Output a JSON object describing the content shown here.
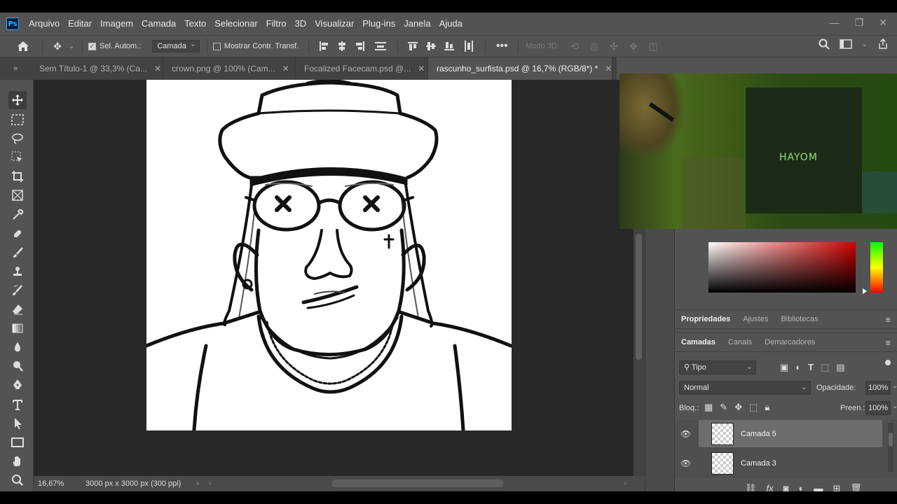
{
  "app": {
    "logo": "Ps"
  },
  "menu": [
    "Arquivo",
    "Editar",
    "Imagem",
    "Camada",
    "Texto",
    "Selecionar",
    "Filtro",
    "3D",
    "Visualizar",
    "Plug-ins",
    "Janela",
    "Ajuda"
  ],
  "options": {
    "auto_select_label": "Sel. Autom.:",
    "auto_select_value": "Camada",
    "transform_controls_label": "Mostrar Contr. Transf.",
    "mode3d_label": "Modo 3D:"
  },
  "tabs": [
    {
      "label": "Sem Título-1 @ 33,3% (Ca..."
    },
    {
      "label": "crown.png @ 100% (Cam..."
    },
    {
      "label": "Focalized Facecam.psd @..."
    },
    {
      "label": "rascunho_surfista.psd @ 16,7% (RGB/8*) *"
    }
  ],
  "status": {
    "zoom": "16,67%",
    "doc_info": "3000 px x 3000 px (300 ppi)"
  },
  "webcam": {
    "brand_text": "HAYOM"
  },
  "props_tabs": [
    "Propriedades",
    "Ajustes",
    "Bibliotecas"
  ],
  "layers_tabs": [
    "Camadas",
    "Canais",
    "Demarcadores"
  ],
  "layers_panel": {
    "filter_value": "Tipo",
    "blend_mode": "Normal",
    "opacity_label": "Opacidade:",
    "opacity_value": "100%",
    "lock_label": "Bloq.:",
    "fill_label": "Preen.:",
    "fill_value": "100%",
    "layers": [
      {
        "name": "Camada 5"
      },
      {
        "name": "Camada 3"
      }
    ]
  },
  "colors": {
    "accent": "#31a8ff",
    "panel": "#535353",
    "canvas_bg": "#282828"
  }
}
